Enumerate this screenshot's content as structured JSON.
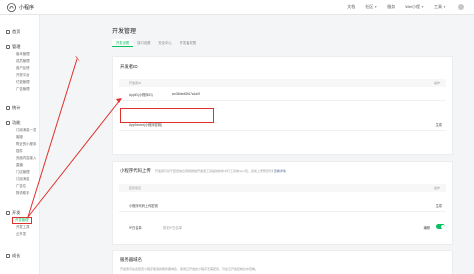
{
  "app": {
    "name": "小程序"
  },
  "topnav": {
    "items": [
      "文档",
      "社区",
      "服务",
      "Wei小程"
    ],
    "tools": "工具"
  },
  "sidebar": {
    "groups": [
      {
        "label": "首页",
        "icon": "home-icon",
        "items": []
      },
      {
        "label": "管理",
        "icon": "manage-icon",
        "items": [
          "版本管理",
          "成员管理",
          "用户反馈",
          "开放平台",
          "付费管理",
          "广告管理"
        ]
      },
      {
        "label": "统计",
        "icon": "stats-icon",
        "items": []
      },
      {
        "label": "功能",
        "icon": "feature-icon",
        "items": [
          "订阅消息一览",
          "客服",
          "附近的小程序",
          "插件",
          "页面内容接入",
          "直播",
          "门店管理",
          "订阅消息",
          "广告位",
          "物流助手"
        ]
      },
      {
        "label": "开发",
        "icon": "dev-icon",
        "items": [
          "开发管理",
          "开发工具",
          "云开发"
        ]
      },
      {
        "label": "成长",
        "icon": "growth-icon",
        "items": []
      }
    ],
    "active_item": "开发管理"
  },
  "page": {
    "title": "开发管理",
    "tabs": [
      "开发设置",
      "接口设置",
      "安全中心",
      "开发者权限"
    ],
    "active_tab": "开发设置"
  },
  "developer_id": {
    "title": "开发者ID",
    "col_header": "开发者ID",
    "col_action": "操作",
    "appid_label": "AppID(小程序ID)",
    "appid_value": "wx34fab62fd7a1a0f",
    "secret_label": "AppSecret(小程序密钥)",
    "secret_action": "生成"
  },
  "code_upload": {
    "title": "小程序代码上传",
    "desc": "开发者可基于配置信息调用微信开发者工具提供的命令行工具或npm包，完成上传预览代码等操作。",
    "link": "查看详情",
    "col_header": "配置项目",
    "col_action": "操作",
    "row1_label": "小程序代码上传密钥",
    "row1_action": "生成",
    "row2_label": "IP白名单",
    "row2_value": "暂无IP白名单",
    "row2_status": "编辑"
  },
  "server_domain": {
    "title": "服务器域名",
    "desc": "开发者可在此配置小程序使用的服务器域名，使用云开发的小程序无需配置，可在云开发控制台中查看。"
  },
  "colors": {
    "accent": "#07c160",
    "highlight": "#e0302b",
    "link": "#576b95"
  }
}
